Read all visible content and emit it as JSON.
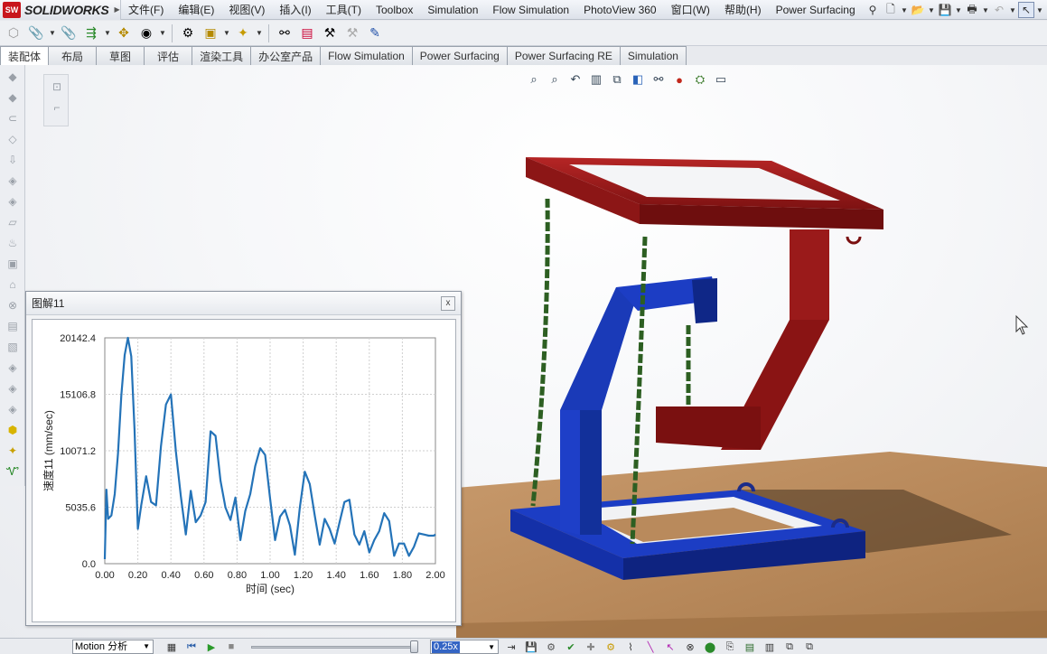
{
  "app": {
    "brand": "SOLIDWORKS",
    "logo_badge": "SW"
  },
  "menu": {
    "items": [
      "文件(F)",
      "编辑(E)",
      "视图(V)",
      "插入(I)",
      "工具(T)",
      "Toolbox",
      "Simulation",
      "Flow Simulation",
      "PhotoView 360",
      "窗口(W)",
      "帮助(H)",
      "Power Surfacing"
    ]
  },
  "tabs": [
    {
      "label": "装配体",
      "active": true
    },
    {
      "label": "布局",
      "active": false
    },
    {
      "label": "草图",
      "active": false
    },
    {
      "label": "评估",
      "active": false
    },
    {
      "label": "渲染工具",
      "active": false
    },
    {
      "label": "办公室产品",
      "active": false
    },
    {
      "label": "Flow Simulation",
      "active": false
    },
    {
      "label": "Power Surfacing",
      "active": false
    },
    {
      "label": "Power Surfacing RE",
      "active": false
    },
    {
      "label": "Simulation",
      "active": false
    }
  ],
  "graph": {
    "window_title": "图解11",
    "close_label": "x"
  },
  "chart_data": {
    "type": "line",
    "title": "",
    "xlabel": "时间 (sec)",
    "ylabel": "速度11 (mm/sec)",
    "xlim": [
      0.0,
      2.0
    ],
    "ylim": [
      0.0,
      20142.4
    ],
    "x_ticks": [
      "0.00",
      "0.20",
      "0.40",
      "0.60",
      "0.80",
      "1.00",
      "1.20",
      "1.40",
      "1.60",
      "1.80",
      "2.00"
    ],
    "y_ticks": [
      "0.0",
      "5035.6",
      "10071.2",
      "15106.8",
      "20142.4"
    ],
    "grid": true,
    "color": "#2473b8",
    "series": [
      {
        "name": "",
        "x": [
          0.0,
          0.01,
          0.02,
          0.04,
          0.06,
          0.08,
          0.1,
          0.12,
          0.14,
          0.16,
          0.18,
          0.2,
          0.22,
          0.25,
          0.28,
          0.31,
          0.34,
          0.37,
          0.4,
          0.43,
          0.46,
          0.49,
          0.52,
          0.55,
          0.58,
          0.61,
          0.64,
          0.67,
          0.7,
          0.73,
          0.76,
          0.79,
          0.82,
          0.85,
          0.88,
          0.91,
          0.94,
          0.97,
          1.0,
          1.03,
          1.06,
          1.09,
          1.12,
          1.15,
          1.18,
          1.21,
          1.24,
          1.27,
          1.3,
          1.33,
          1.36,
          1.39,
          1.42,
          1.45,
          1.48,
          1.51,
          1.54,
          1.57,
          1.6,
          1.63,
          1.66,
          1.69,
          1.72,
          1.75,
          1.78,
          1.81,
          1.84,
          1.87,
          1.9,
          1.93,
          1.96,
          1.99,
          2.0
        ],
        "values": [
          400,
          6600,
          4000,
          4300,
          6200,
          9800,
          15000,
          18600,
          20142,
          18500,
          12000,
          3100,
          5200,
          7800,
          5500,
          5200,
          10500,
          14200,
          15100,
          10000,
          6000,
          2600,
          6500,
          3700,
          4300,
          5500,
          11800,
          11400,
          7400,
          5000,
          3900,
          5900,
          2100,
          4700,
          6200,
          8700,
          10300,
          9700,
          5800,
          2100,
          4200,
          4800,
          3400,
          800,
          5000,
          8200,
          7100,
          4300,
          1700,
          4000,
          3100,
          1800,
          3700,
          5500,
          5700,
          2600,
          1700,
          2900,
          1000,
          2100,
          2900,
          4500,
          3800,
          700,
          1800,
          1800,
          700,
          1500,
          2700,
          2600,
          2500,
          2500,
          2600
        ]
      }
    ]
  },
  "motion_bar": {
    "study_type": "Motion 分析",
    "playback_speed": "0.25x",
    "speed_caret": "▼"
  },
  "icons": {
    "view_toolbar": [
      "zoom-to-fit-icon",
      "zoom-area-icon",
      "previous-view-icon",
      "section-view-icon",
      "view-orientation-icon",
      "display-style-icon",
      "hide-show-icon",
      "edit-appearance-icon",
      "apply-scene-icon",
      "view-settings-icon"
    ]
  }
}
